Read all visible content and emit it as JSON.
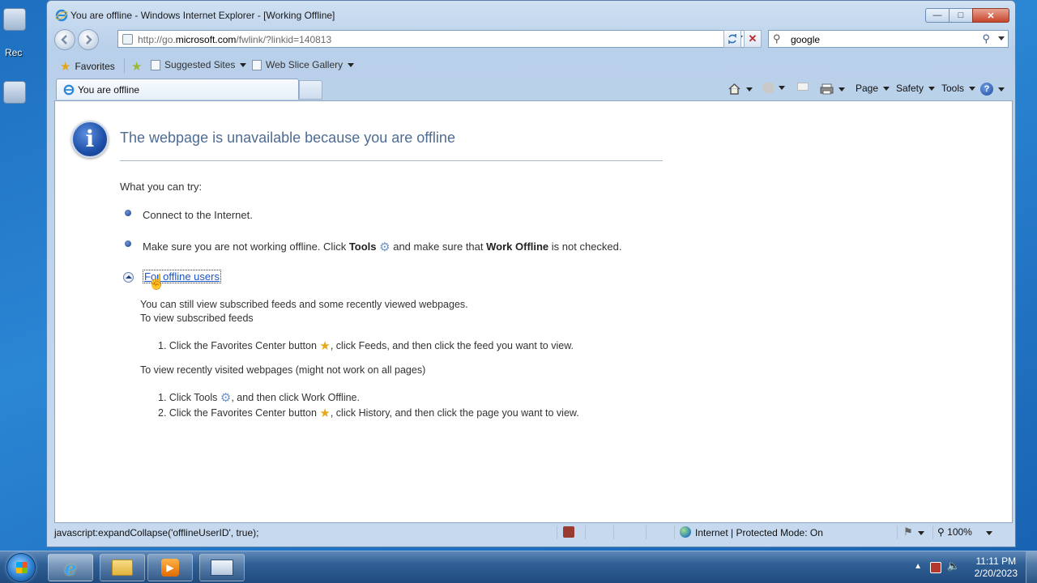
{
  "window": {
    "title": "You are offline - Windows Internet Explorer - [Working Offline]"
  },
  "navigation": {
    "address_url": "http://go.microsoft.com/fwlink/?linkid=140813",
    "search_value": "google"
  },
  "favorites_bar": {
    "favorites_label": "Favorites",
    "suggested_sites_label": "Suggested Sites",
    "web_slice_label": "Web Slice Gallery"
  },
  "tab": {
    "label": "You are offline"
  },
  "command_bar": {
    "page_label": "Page",
    "safety_label": "Safety",
    "tools_label": "Tools"
  },
  "content": {
    "heading": "The webpage is unavailable because you are offline",
    "try_label": "What you can try:",
    "bullet1": "Connect to the Internet.",
    "bullet2_part1": "Make sure you are not working offline. Click ",
    "bullet2_tools": "Tools",
    "bullet2_part2": " and make sure that ",
    "bullet2_work_offline": "Work Offline",
    "bullet2_part3": " is not checked.",
    "offline_link": "For offline users",
    "offline_para1": "You can still view subscribed feeds and some recently viewed webpages.",
    "offline_para2": "To view subscribed feeds",
    "feeds_step1_a": "1.  Click the Favorites Center button ",
    "feeds_step1_b": ", click Feeds, and then click the feed you want to view.",
    "recent_heading": "To view recently visited webpages (might not work on all pages)",
    "recent_step1_a": "1.  Click Tools ",
    "recent_step1_b": ", and then click Work Offline.",
    "recent_step2_a": "2.  Click the Favorites Center button ",
    "recent_step2_b": ", click History, and then click the page you want to view."
  },
  "status_bar": {
    "text": "javascript:expandCollapse('offlineUserID', true);",
    "zone": "Internet | Protected Mode: On",
    "zoom": "100%"
  },
  "desktop": {
    "partial_label": "Rec"
  },
  "taskbar": {
    "time": "11:11 PM",
    "date": "2/20/2023"
  },
  "icons": {
    "info": "information-icon",
    "gear": "gear-icon",
    "star": "star-icon"
  }
}
